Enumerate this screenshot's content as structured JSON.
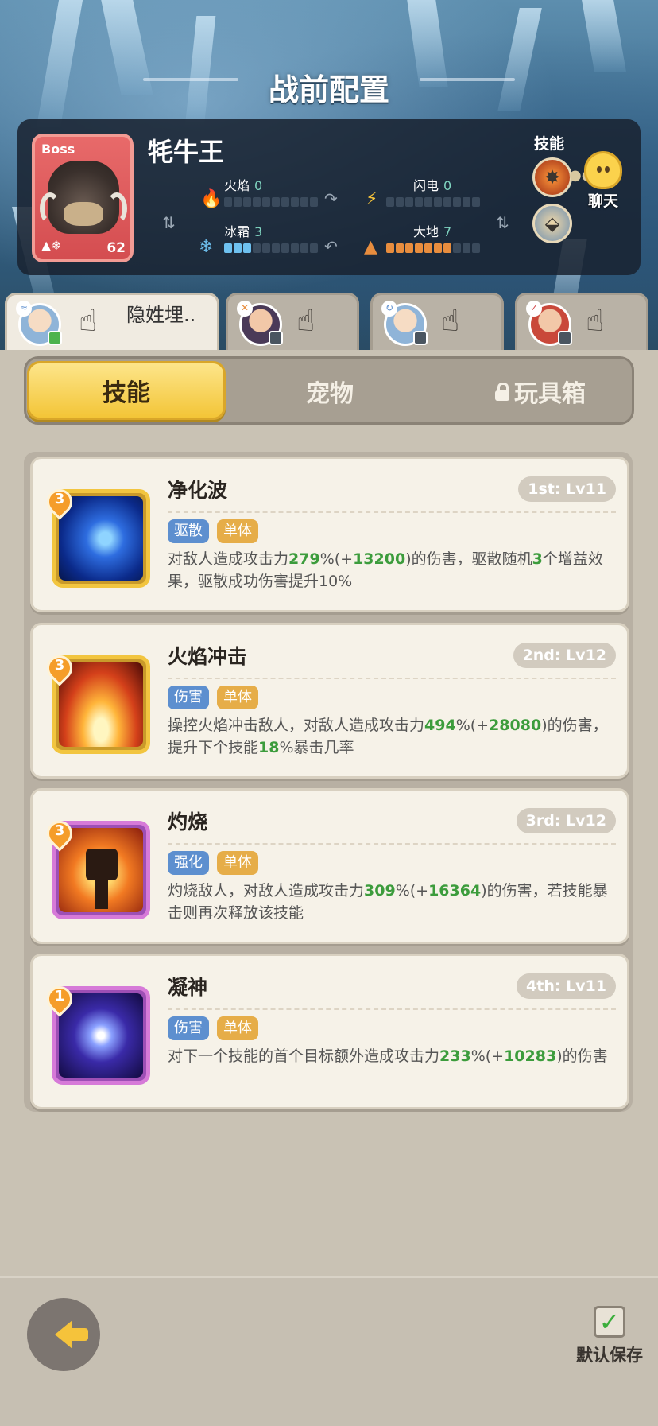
{
  "header": {
    "title": "战前配置"
  },
  "boss": {
    "tag": "Boss",
    "name": "牦牛王",
    "level": "62",
    "stats": {
      "fire": {
        "label": "火焰",
        "value": "0",
        "level": 0
      },
      "lightning": {
        "label": "闪电",
        "value": "0",
        "level": 0
      },
      "frost": {
        "label": "冰霜",
        "value": "3",
        "level": 3
      },
      "earth": {
        "label": "大地",
        "value": "7",
        "level": 7
      }
    },
    "skills_label": "技能"
  },
  "chat": {
    "label": "聊天"
  },
  "heroes": [
    {
      "name": "隐姓埋..",
      "selected": true
    },
    {
      "name": "",
      "selected": false
    },
    {
      "name": "",
      "selected": false
    },
    {
      "name": "",
      "selected": false
    }
  ],
  "tabs": {
    "skills": "技能",
    "pets": "宠物",
    "toybox": "玩具箱",
    "active": "skills"
  },
  "skills": [
    {
      "name": "净化波",
      "rank": "1st: Lv11",
      "level_badge": "3",
      "tags": [
        "驱散",
        "单体"
      ],
      "desc_parts": [
        "对敌人造成攻击力",
        "279",
        "%(+",
        "13200",
        ")的伤害，驱散随机",
        "3",
        "个增益效果，驱散成功伤害提升10%"
      ]
    },
    {
      "name": "火焰冲击",
      "rank": "2nd: Lv12",
      "level_badge": "3",
      "tags": [
        "伤害",
        "单体"
      ],
      "desc_parts": [
        "操控火焰冲击敌人，对敌人造成攻击力",
        "494",
        "%(+",
        "28080",
        ")的伤害，提升下个技能",
        "18",
        "%暴击几率"
      ]
    },
    {
      "name": "灼烧",
      "rank": "3rd: Lv12",
      "level_badge": "3",
      "tags": [
        "强化",
        "单体"
      ],
      "desc_parts": [
        "灼烧敌人，对敌人造成攻击力",
        "309",
        "%(+",
        "16364",
        ")的伤害，若技能暴击则再次释放该技能"
      ]
    },
    {
      "name": "凝神",
      "rank": "4th: Lv11",
      "level_badge": "1",
      "tags": [
        "伤害",
        "单体"
      ],
      "desc_parts": [
        "对下一个技能的首个目标额外造成攻击力",
        "233",
        "%(+",
        "10283",
        ")的伤害"
      ]
    }
  ],
  "footer": {
    "save_label": "默认保存"
  },
  "colors": {
    "accent_yellow": "#f3c537",
    "highlight_green": "#3c9c3c",
    "tag_blue": "#5d8fcf",
    "tag_orange": "#e6ad48"
  }
}
